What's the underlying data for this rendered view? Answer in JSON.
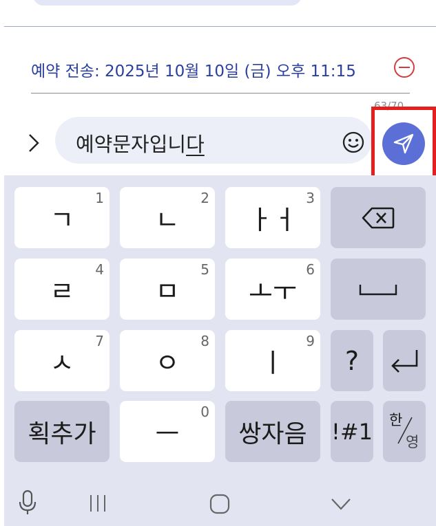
{
  "top": {
    "partial_text": "ᅠ, ᅠᅠ"
  },
  "schedule": {
    "text": "예약 전송: 2025년 10월 10일 (금) 오후 11:15"
  },
  "counter": "63/70",
  "composer": {
    "text_main": "예약문자입니",
    "text_composing": "다"
  },
  "keyboard": {
    "rows": [
      [
        {
          "label": "ㄱ",
          "num": "1"
        },
        {
          "label": "ㄴ",
          "num": "2"
        },
        {
          "label": "ㅏㅓ",
          "num": "3"
        }
      ],
      [
        {
          "label": "ㄹ",
          "num": "4"
        },
        {
          "label": "ㅁ",
          "num": "5"
        },
        {
          "label": "ㅗㅜ",
          "num": "6"
        }
      ],
      [
        {
          "label": "ㅅ",
          "num": "7"
        },
        {
          "label": "ㅇ",
          "num": "8"
        },
        {
          "label": "ㅣ",
          "num": "9"
        }
      ],
      [
        {
          "label": "획추가",
          "num": ""
        },
        {
          "label": "ㅡ",
          "num": "0"
        },
        {
          "label": "쌍자음",
          "num": ""
        }
      ]
    ],
    "question": "?",
    "symbols": "!#1",
    "lang_top": "한",
    "lang_bottom": "영",
    "icons": {
      "backspace": "backspace-icon",
      "space": "space-icon",
      "enter": "enter-icon",
      "mic": "microphone-icon",
      "send": "send-icon"
    }
  },
  "colors": {
    "accent": "#5b6fd6",
    "schedule_text": "#2b3f9e",
    "highlight": "#e51e1e",
    "remove": "#d33c3c",
    "keyboard_bg": "#e2e4f1",
    "func_key": "#c8cadb"
  }
}
